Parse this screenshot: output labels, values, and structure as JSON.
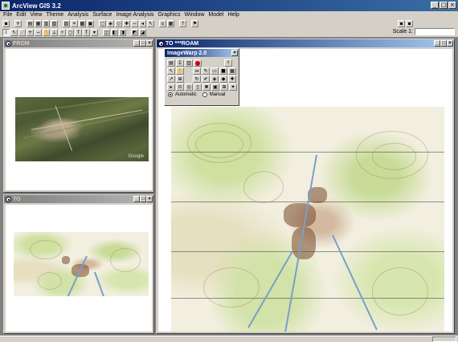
{
  "app": {
    "title": "ArcView GIS 3.2"
  },
  "menu": [
    "File",
    "Edit",
    "View",
    "Theme",
    "Analysis",
    "Surface",
    "Image Analysis",
    "Graphics",
    "Window",
    "Model",
    "Help"
  ],
  "toolbar": {
    "scale_label": "Scale 1:",
    "scale_value": ""
  },
  "windows": {
    "from": {
      "title": "FROM",
      "watermark": "Google"
    },
    "to": {
      "title": "TO"
    },
    "roam": {
      "title": "TO ***ROAM"
    }
  },
  "imagewarp": {
    "title": "ImageWarp 2.0",
    "help_label": "?",
    "automatic_label": "Automatic",
    "manual_label": "Manual",
    "mode": "Automatic"
  },
  "colors": {
    "title_active": "#0a246a",
    "title_inactive": "#808080",
    "face": "#d4d0c8"
  }
}
